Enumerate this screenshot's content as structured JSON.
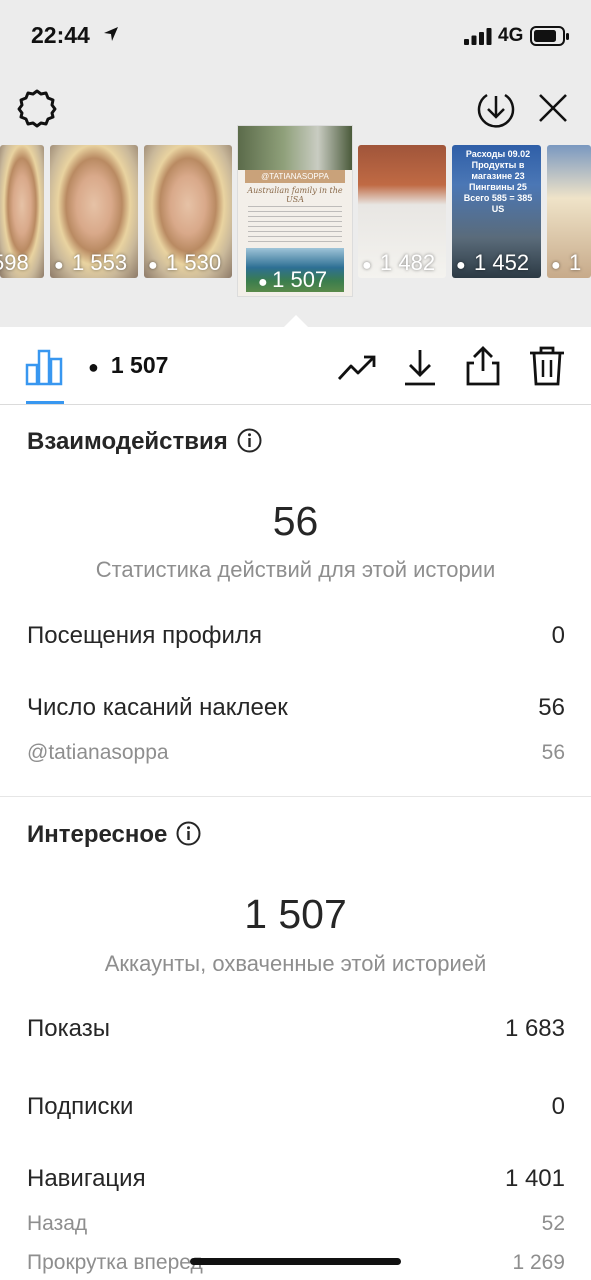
{
  "status_bar": {
    "time": "22:44",
    "network": "4G"
  },
  "thumbnails": [
    {
      "views": "598"
    },
    {
      "views": "1 553"
    },
    {
      "views": "1 530"
    },
    {
      "views": "1 507",
      "handle": "@TATIANASOPPA",
      "script": "Australian family in the USA",
      "selected": true
    },
    {
      "views": "1 482"
    },
    {
      "views": "1 452",
      "caption": "Расходы 09.02 Продукты в магазине 23 Пингвины 25 Всего 585 = 385 US"
    },
    {
      "views": "1"
    }
  ],
  "toolbar": {
    "views": "1 507"
  },
  "interactions": {
    "title": "Взаимодействия",
    "total": "56",
    "subtitle": "Статистика действий для этой истории",
    "rows": [
      {
        "label": "Посещения профиля",
        "value": "0"
      },
      {
        "label": "Число касаний наклеек",
        "value": "56"
      },
      {
        "label": "@tatianasoppa",
        "value": "56"
      }
    ]
  },
  "discovery": {
    "title": "Интересное",
    "total": "1 507",
    "subtitle": "Аккаунты, охваченные этой историей",
    "rows": [
      {
        "label": "Показы",
        "value": "1 683"
      },
      {
        "label": "Подписки",
        "value": "0"
      },
      {
        "label": "Навигация",
        "value": "1 401"
      },
      {
        "label": "Назад",
        "value": "52"
      },
      {
        "label": "Прокрутка вперед",
        "value": "1 269"
      }
    ]
  },
  "colors": {
    "accent": "#3897f0",
    "text": "#262626",
    "secondary": "#8e8e8e",
    "top_bg": "#ececec"
  }
}
